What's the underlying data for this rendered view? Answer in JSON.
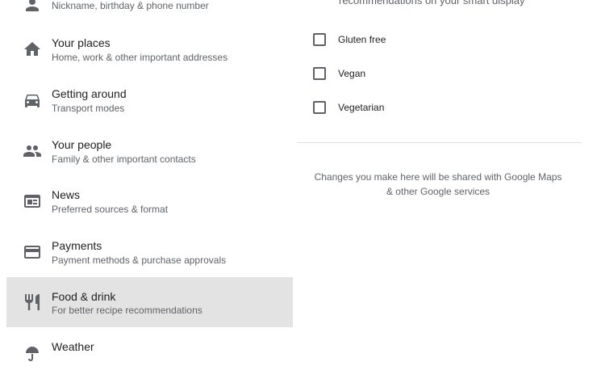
{
  "sidebar": {
    "items": [
      {
        "icon": "person-icon",
        "title": "",
        "subtitle": "Nickname, birthday & phone number"
      },
      {
        "icon": "home-icon",
        "title": "Your places",
        "subtitle": "Home, work & other important addresses"
      },
      {
        "icon": "car-icon",
        "title": "Getting around",
        "subtitle": "Transport modes"
      },
      {
        "icon": "people-icon",
        "title": "Your people",
        "subtitle": "Family & other important contacts"
      },
      {
        "icon": "news-icon",
        "title": "News",
        "subtitle": "Preferred sources & format"
      },
      {
        "icon": "credit-card-icon",
        "title": "Payments",
        "subtitle": "Payment methods & purchase approvals"
      },
      {
        "icon": "restaurant-icon",
        "title": "Food & drink",
        "subtitle": "For better recipe recommendations",
        "selected": true
      },
      {
        "icon": "weather-icon",
        "title": "Weather",
        "subtitle": ""
      }
    ]
  },
  "content": {
    "description_fragment": "recommendations on your smart display",
    "dietary_options": [
      {
        "label": "Gluten free",
        "checked": false
      },
      {
        "label": "Vegan",
        "checked": false
      },
      {
        "label": "Vegetarian",
        "checked": false
      }
    ],
    "footer_note_line1": "Changes you make here will be shared with Google Maps",
    "footer_note_line2": "& other Google services"
  },
  "colors": {
    "selected_background": "#e3e3e3",
    "icon": "#5f6368",
    "text_primary": "#202124",
    "text_secondary": "#5f6368"
  }
}
